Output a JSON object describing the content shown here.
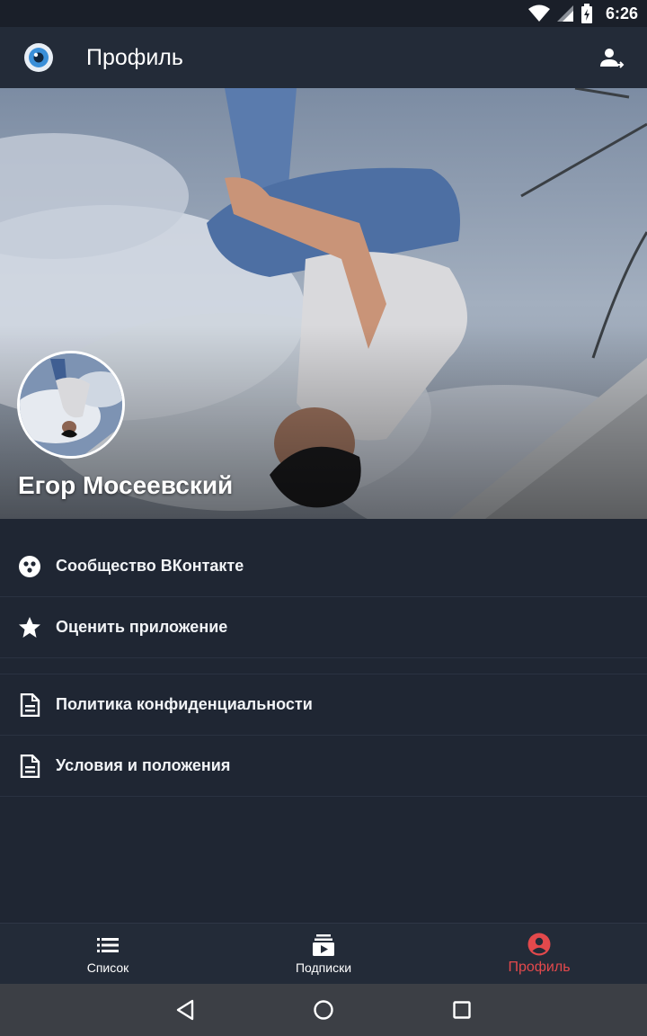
{
  "status_bar": {
    "time": "6:26",
    "icons": [
      "wifi-icon",
      "cell-signal-icon",
      "battery-icon"
    ]
  },
  "app_bar": {
    "title": "Профиль",
    "logo_icon": "eye-logo-icon",
    "action_icon": "switch-account-icon"
  },
  "profile": {
    "name": "Егор Мосеевский"
  },
  "menu": {
    "items": [
      {
        "label": "Сообщество ВКонтакте",
        "icon": "vk-community-icon"
      },
      {
        "label": "Оценить приложение",
        "icon": "star-icon"
      },
      {
        "label": "Политика конфиденциальности",
        "icon": "document-icon"
      },
      {
        "label": "Условия и положения",
        "icon": "document-icon"
      }
    ]
  },
  "bottom_nav": {
    "items": [
      {
        "label": "Список",
        "icon": "list-icon",
        "active": false
      },
      {
        "label": "Подписки",
        "icon": "subscriptions-icon",
        "active": false
      },
      {
        "label": "Профиль",
        "icon": "profile-icon",
        "active": true
      }
    ]
  },
  "system_nav": {
    "icons": [
      "back-icon",
      "home-icon",
      "recents-icon"
    ]
  },
  "colors": {
    "background": "#1f2633",
    "app_bar": "#232b38",
    "accent": "#e3494c",
    "divider": "#2a3241"
  }
}
